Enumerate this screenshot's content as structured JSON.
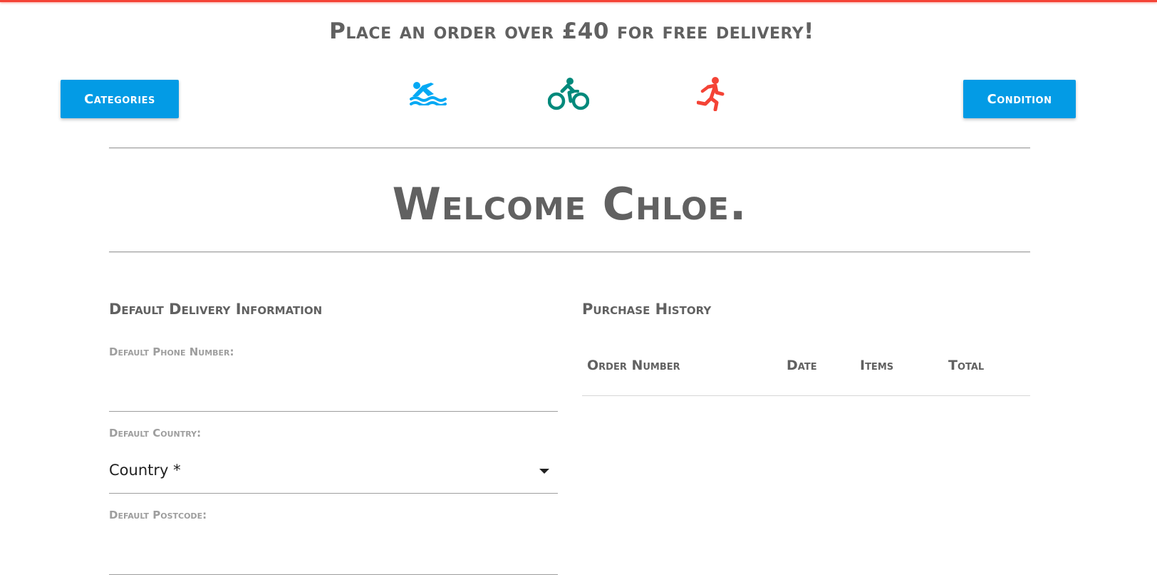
{
  "banner": {
    "text": "Place an order over £40 for free delivery!"
  },
  "nav": {
    "categories_label": "Categories",
    "condition_label": "Condition",
    "sports": [
      {
        "name": "swim",
        "icon": "swimmer-icon",
        "color": "#03a9f4"
      },
      {
        "name": "bike",
        "icon": "cyclist-icon",
        "color": "#00897b"
      },
      {
        "name": "run",
        "icon": "runner-icon",
        "color": "#f44336"
      }
    ],
    "button_color": "#039be5"
  },
  "welcome": {
    "text": "Welcome Chloe."
  },
  "delivery": {
    "title": "Default Delivery Information",
    "phone_label": "Default Phone Number:",
    "phone_value": "",
    "country_label": "Default Country:",
    "country_selected": "Country *",
    "postcode_label": "Default Postcode:",
    "postcode_value": ""
  },
  "history": {
    "title": "Purchase History",
    "columns": [
      "Order Number",
      "Date",
      "Items",
      "Total"
    ],
    "rows": []
  }
}
